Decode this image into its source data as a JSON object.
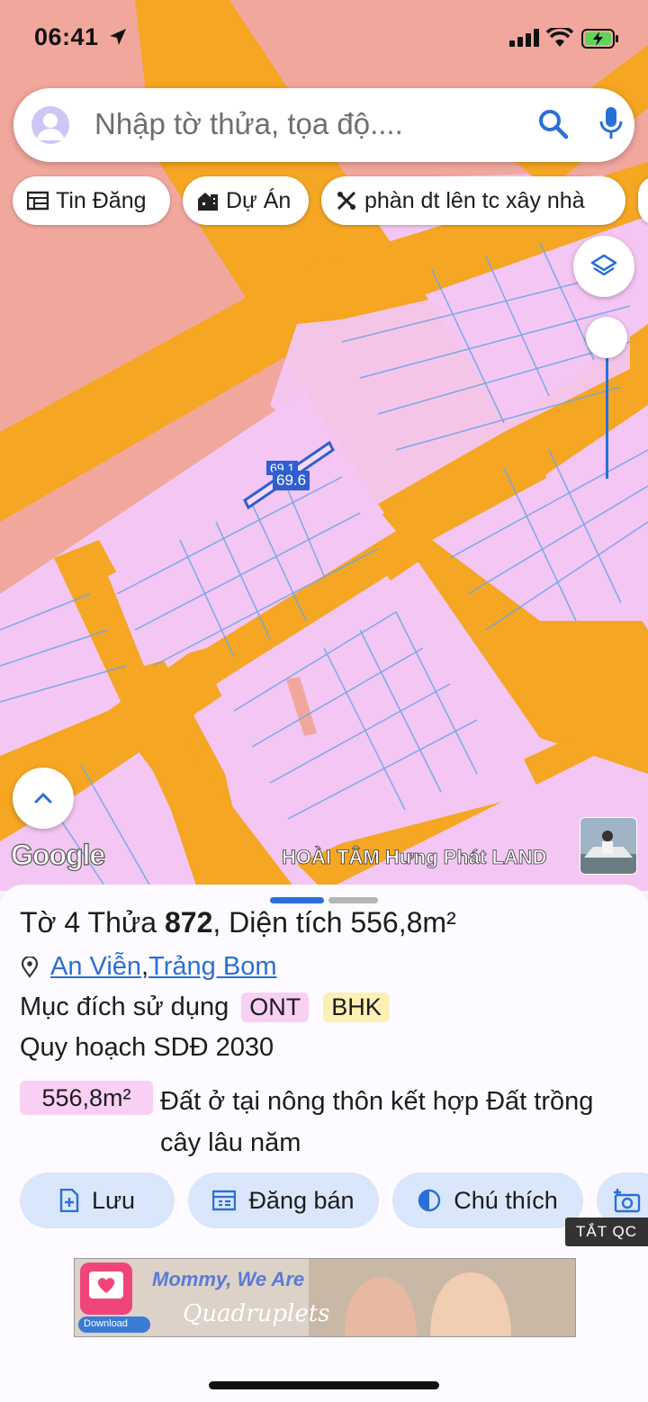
{
  "status_bar": {
    "time": "06:41"
  },
  "search": {
    "placeholder": "Nhập tờ thửa, tọa độ...."
  },
  "chips": [
    {
      "label": "Tin Đăng",
      "icon": "news-icon"
    },
    {
      "label": "Dự Án",
      "icon": "building-icon"
    },
    {
      "label": "phàn dt lên tc xây nhà",
      "icon": "tools-icon"
    }
  ],
  "map": {
    "plot_label": "69.6",
    "plot_label_behind": "69.1",
    "attribution": "Google",
    "watermark": "HOÀI TÂM Hưng Phát LAND"
  },
  "sheet": {
    "title_prefix": "Tờ ",
    "sheet_no": "4",
    "title_mid": " Thửa ",
    "parcel_no": "872",
    "title_area_label": ", Diện tích ",
    "area": "556,8m²",
    "commune": "An Viễn",
    "separator": ", ",
    "district": "Trảng Bom",
    "purpose_label": "Mục đích sử dụng",
    "purpose_tags": [
      "ONT",
      "BHK"
    ],
    "plan_label": "Quy hoạch SDĐ 2030",
    "plan_area": "556,8m²",
    "plan_desc": "Đất ở tại nông thôn kết hợp Đất trồng cây lâu năm"
  },
  "actions": {
    "save": "Lưu",
    "post_sale": "Đăng bán",
    "legend": "Chú thích"
  },
  "ad": {
    "close_label": "TẮT QC",
    "headline": "Mommy, We Are",
    "script_text": "Quadruplets",
    "download_label": "Download"
  },
  "colors": {
    "residential_plan": "#f4c6f3",
    "road": "#f5a623",
    "urban": "#f2a79d",
    "parcel_line": "#6aa8e8",
    "accent_blue": "#2a6fd6"
  }
}
